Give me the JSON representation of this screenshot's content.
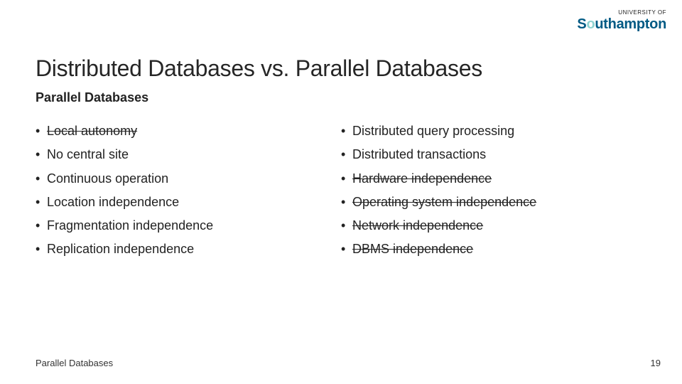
{
  "logo": {
    "top": "UNIVERSITY OF",
    "main_pre": "S",
    "main_accent": "o",
    "main_post": "uthampton"
  },
  "title": "Distributed Databases vs. Parallel Databases",
  "subtitle": "Parallel Databases",
  "left_items": [
    {
      "text": "Local autonomy",
      "struck": true
    },
    {
      "text": "No central site",
      "struck": false
    },
    {
      "text": "Continuous operation",
      "struck": false
    },
    {
      "text": "Location independence",
      "struck": false
    },
    {
      "text": "Fragmentation independence",
      "struck": false
    },
    {
      "text": "Replication independence",
      "struck": false
    }
  ],
  "right_items": [
    {
      "text": "Distributed query processing",
      "struck": false
    },
    {
      "text": "Distributed transactions",
      "struck": false
    },
    {
      "text": "Hardware independence",
      "struck": true
    },
    {
      "text": "Operating system independence",
      "struck": true
    },
    {
      "text": "Network independence",
      "struck": true
    },
    {
      "text": "DBMS independence",
      "struck": true
    }
  ],
  "footer": {
    "left": "Parallel Databases",
    "page": "19"
  }
}
